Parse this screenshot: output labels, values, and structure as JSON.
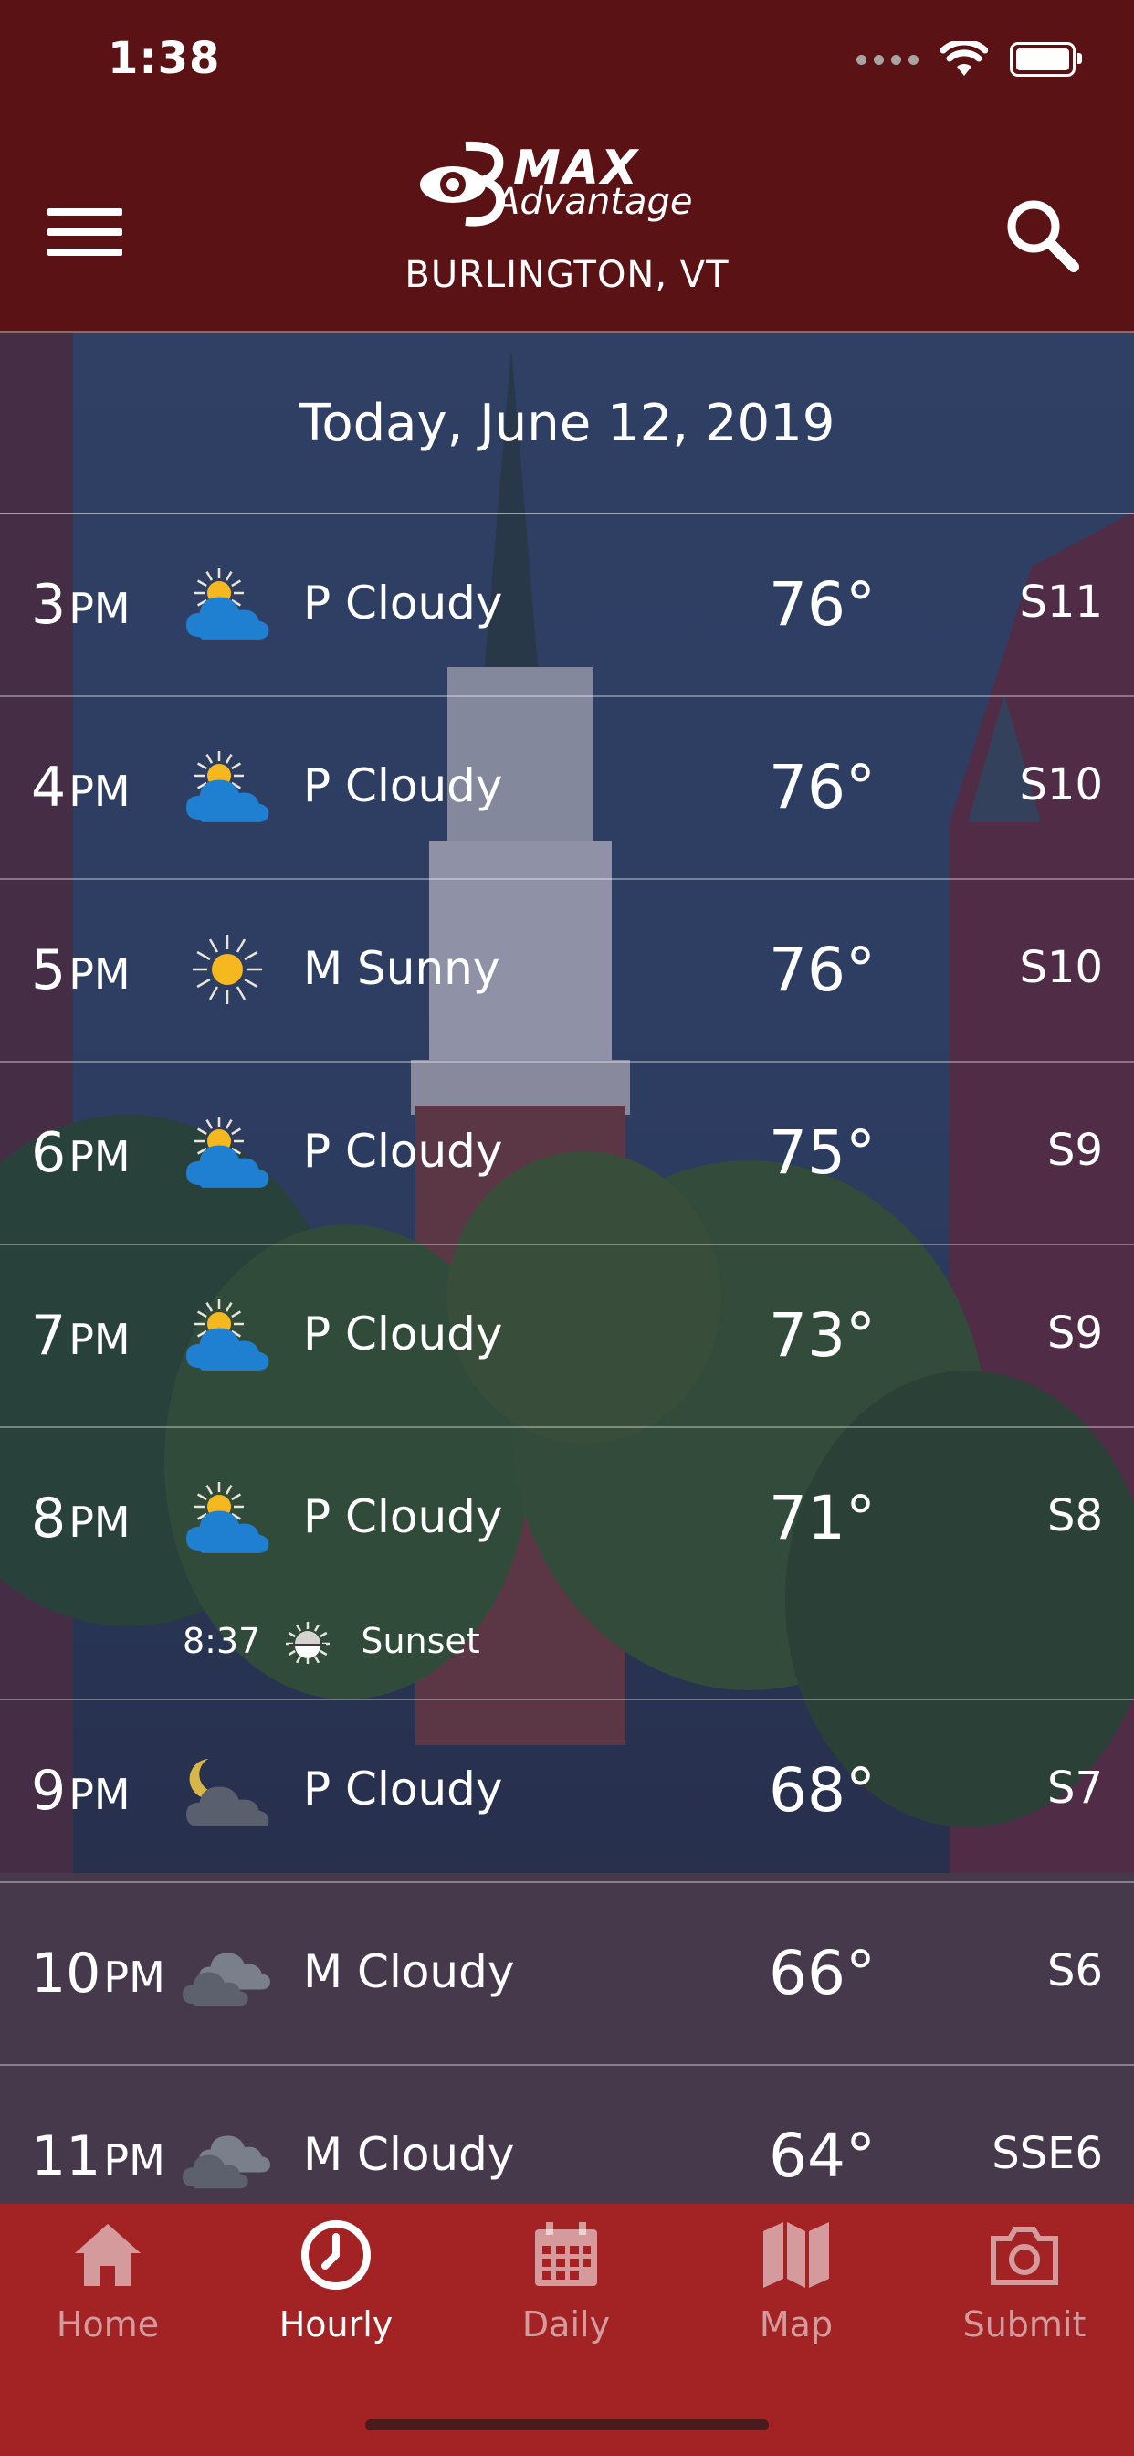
{
  "status_bar": {
    "time": "1:38"
  },
  "header": {
    "logo": {
      "brand_number": "3",
      "max": "MAX",
      "advantage": "Advantage"
    },
    "location": "BURLINGTON, VT"
  },
  "forecast": {
    "date": "Today, June 12, 2019",
    "hours": [
      {
        "hour": "3",
        "ampm": "PM",
        "icon": "partly-cloudy-day-icon",
        "condition": "P Cloudy",
        "temp": "76°",
        "wind": "S11"
      },
      {
        "hour": "4",
        "ampm": "PM",
        "icon": "partly-cloudy-day-icon",
        "condition": "P Cloudy",
        "temp": "76°",
        "wind": "S10"
      },
      {
        "hour": "5",
        "ampm": "PM",
        "icon": "sunny-icon",
        "condition": "M Sunny",
        "temp": "76°",
        "wind": "S10"
      },
      {
        "hour": "6",
        "ampm": "PM",
        "icon": "partly-cloudy-day-icon",
        "condition": "P Cloudy",
        "temp": "75°",
        "wind": "S9"
      },
      {
        "hour": "7",
        "ampm": "PM",
        "icon": "partly-cloudy-day-icon",
        "condition": "P Cloudy",
        "temp": "73°",
        "wind": "S9"
      },
      {
        "hour": "8",
        "ampm": "PM",
        "icon": "partly-cloudy-day-icon",
        "condition": "P Cloudy",
        "temp": "71°",
        "wind": "S8",
        "sunset_time": "8:37",
        "sunset_label": "Sunset"
      },
      {
        "hour": "9",
        "ampm": "PM",
        "icon": "partly-cloudy-night-icon",
        "condition": "P Cloudy",
        "temp": "68°",
        "wind": "S7"
      },
      {
        "hour": "10",
        "ampm": "PM",
        "icon": "mostly-cloudy-icon",
        "condition": "M Cloudy",
        "temp": "66°",
        "wind": "S6"
      },
      {
        "hour": "11",
        "ampm": "PM",
        "icon": "mostly-cloudy-icon",
        "condition": "M Cloudy",
        "temp": "64°",
        "wind": "SSE6"
      }
    ]
  },
  "tabs": [
    {
      "label": "Home",
      "icon": "home-icon",
      "active": false
    },
    {
      "label": "Hourly",
      "icon": "clock-icon",
      "active": true
    },
    {
      "label": "Daily",
      "icon": "calendar-icon",
      "active": false
    },
    {
      "label": "Map",
      "icon": "map-icon",
      "active": false
    },
    {
      "label": "Submit",
      "icon": "camera-icon",
      "active": false
    }
  ],
  "colors": {
    "header_bg": "#5a1215",
    "tabbar_bg": "#a32224",
    "sun": "#f6b81f",
    "cloud": "#1f7fd0"
  }
}
